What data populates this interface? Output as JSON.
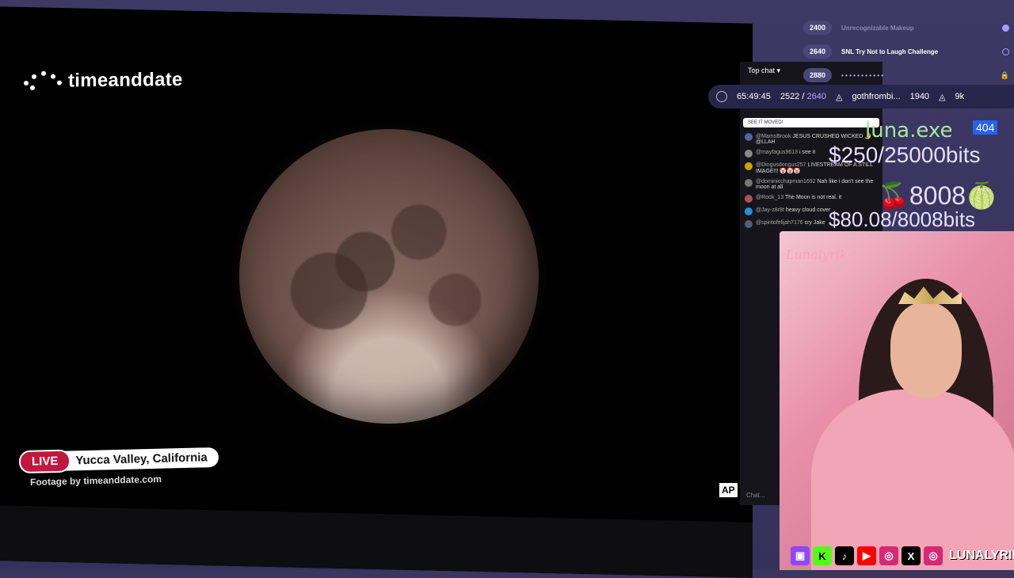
{
  "video": {
    "logo_text": "timeanddate",
    "live_label": "LIVE",
    "location": "Yucca Valley, California",
    "footage_credit": "Footage by timeanddate.com",
    "corner_badge": "AP"
  },
  "chat": {
    "header": "Top chat",
    "pinned": "SEE IT MOVED!",
    "messages": [
      {
        "user": "@MamsBrook",
        "text": "JESUS CRUSHED WICKED 🌙 @LLAH"
      },
      {
        "user": "@mayfagus9613",
        "text": "i see it"
      },
      {
        "user": "@Dingusdongus257",
        "text": "LIVESTREAM OF A STILL IMAGE!!! 🤡🤡🤡"
      },
      {
        "user": "@dominicchapman1692",
        "text": "Nah like i don't see the moon at all"
      },
      {
        "user": "@Rook_13",
        "text": "The Moon is not real. it"
      },
      {
        "user": "@Jay-z8r8t",
        "text": "heavy cloud cover"
      },
      {
        "user": "@spiritofelijah7176",
        "text": "cry Jake"
      }
    ],
    "input_placeholder": "Chat..."
  },
  "stats": {
    "timer": "65:49:45",
    "progress_current": "2522",
    "progress_target": "2640",
    "top_user": "gothfrombi...",
    "top_user_amount": "1940",
    "bits_total": "9k"
  },
  "goals": [
    {
      "amount": "2400",
      "label": "Unrecognizable Makeup"
    },
    {
      "amount": "2640",
      "label": "SNL Try Not to Laugh Challenge"
    },
    {
      "amount": "2880",
      "label": ""
    }
  ],
  "overlay": {
    "luna_exe": "luna.exe",
    "tag404": "404",
    "bits_goal1": "$250/25000bits",
    "goal_8008": "8008",
    "bits_goal2": "$80.08/8008bits"
  },
  "webcam": {
    "sign": "Lunalyrik"
  },
  "socials": {
    "handle": "LUNALYRIK",
    "icons": [
      "twitch-icon",
      "kick-icon",
      "tiktok-icon",
      "youtube-icon",
      "instagram-icon",
      "x-icon",
      "instagram-icon"
    ]
  }
}
